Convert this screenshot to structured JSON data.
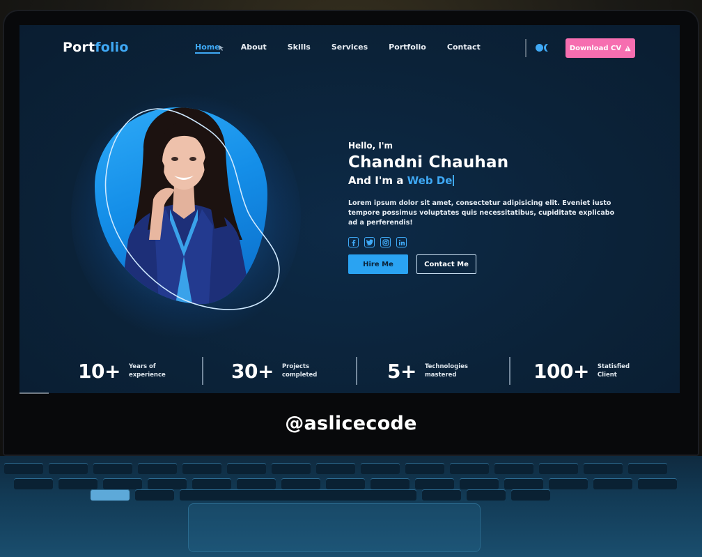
{
  "nav": {
    "logo_main": "Port",
    "logo_accent": "folio",
    "links": [
      "Home",
      "About",
      "Skills",
      "Services",
      "Portfolio",
      "Contact"
    ],
    "active_link": "Home",
    "download_cv": "Download CV",
    "download_icon": "warning-triangle-icon"
  },
  "hero": {
    "greeting": "Hello, I'm",
    "name": "Chandni Chauhan",
    "role_prefix": "And I'm a",
    "role_typed": "Web De",
    "description": "Lorem ipsum dolor sit amet, consectetur adipisicing elit. Eveniet iusto tempore possimus voluptates quis necessitatibus, cupiditate explicabo ad a perferendis!",
    "socials": [
      "facebook-icon",
      "twitter-icon",
      "instagram-icon",
      "linkedin-icon"
    ],
    "hire_button": "Hire Me",
    "contact_button": "Contact Me"
  },
  "stats": [
    {
      "value": "10+",
      "label": "Years of\nexperience"
    },
    {
      "value": "30+",
      "label": "Projects\ncompleted"
    },
    {
      "value": "5+",
      "label": "Technologies\nmastered"
    },
    {
      "value": "100+",
      "label": "Statisfied\nClient"
    }
  ],
  "watermark": "@aslicecode",
  "colors": {
    "accent": "#3fa9f5",
    "cv_button": "#f66eb0",
    "background": "#0b2238"
  }
}
